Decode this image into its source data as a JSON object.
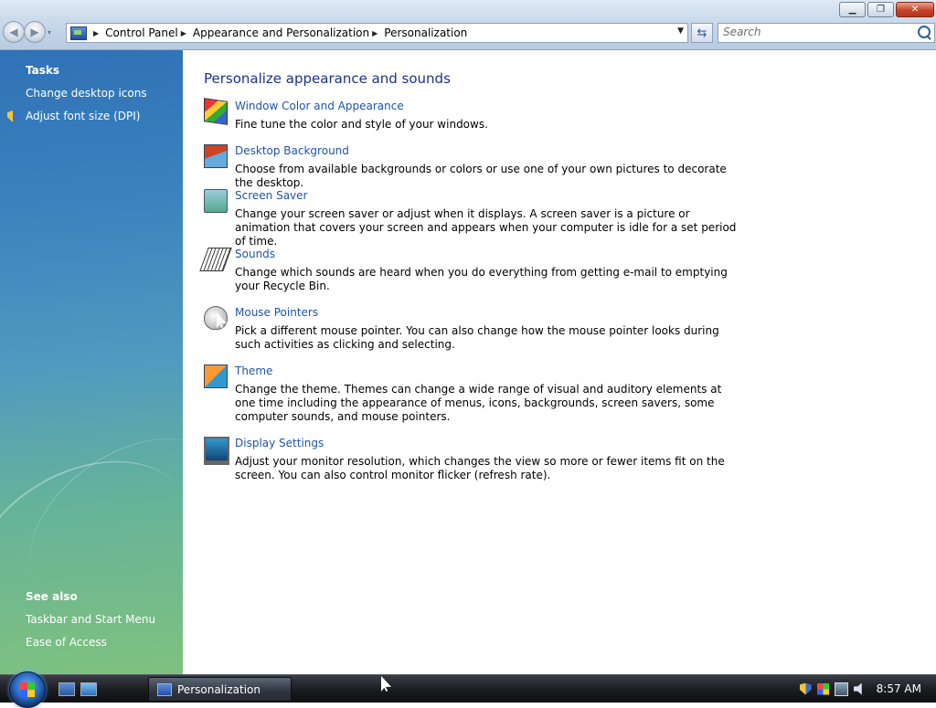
{
  "window": {
    "minimize_symbol": "▁",
    "maximize_symbol": "❐",
    "close_symbol": "✕"
  },
  "nav": {
    "back_symbol": "◀",
    "forward_symbol": "▶",
    "dropdown_symbol": "▾"
  },
  "address": {
    "breadcrumbs": [
      "Control Panel",
      "Appearance and Personalization",
      "Personalization"
    ],
    "separator": "▶",
    "dropdown_symbol": "▼",
    "refresh_symbol": "⇆"
  },
  "search": {
    "placeholder": "Search"
  },
  "sidebar": {
    "tasks_heading": "Tasks",
    "tasks": [
      {
        "label": "Change desktop icons"
      },
      {
        "label": "Adjust font size (DPI)",
        "icon": "uac-shield-icon"
      }
    ],
    "see_also_heading": "See also",
    "see_also": [
      {
        "label": "Taskbar and Start Menu"
      },
      {
        "label": "Ease of Access"
      }
    ]
  },
  "main": {
    "title": "Personalize appearance and sounds",
    "items": [
      {
        "label": "Window Color and Appearance",
        "description": "Fine tune the color and style of your windows.",
        "icon": "window-color-icon"
      },
      {
        "label": "Desktop Background",
        "description": "Choose from available backgrounds or colors or use one of your own pictures to decorate the desktop.",
        "icon": "desktop-background-icon"
      },
      {
        "label": "Screen Saver",
        "description": "Change your screen saver or adjust when it displays. A screen saver is a picture or animation that covers your screen and appears when your computer is idle for a set period of time.",
        "icon": "screen-saver-icon"
      },
      {
        "label": "Sounds",
        "description": "Change which sounds are heard when you do everything from getting e-mail to emptying your Recycle Bin.",
        "icon": "sounds-icon"
      },
      {
        "label": "Mouse Pointers",
        "description": "Pick a different mouse pointer. You can also change how the mouse pointer looks during such activities as clicking and selecting.",
        "icon": "mouse-pointers-icon"
      },
      {
        "label": "Theme",
        "description": "Change the theme. Themes can change a wide range of visual and auditory elements at one time including the appearance of menus, icons, backgrounds, screen savers, some computer sounds, and mouse pointers.",
        "icon": "theme-icon"
      },
      {
        "label": "Display Settings",
        "description": "Adjust your monitor resolution, which changes the view so more or fewer items fit on the screen. You can also control monitor flicker (refresh rate).",
        "icon": "display-settings-icon"
      }
    ]
  },
  "taskbar": {
    "task_label": "Personalization",
    "clock": "8:57 AM"
  }
}
